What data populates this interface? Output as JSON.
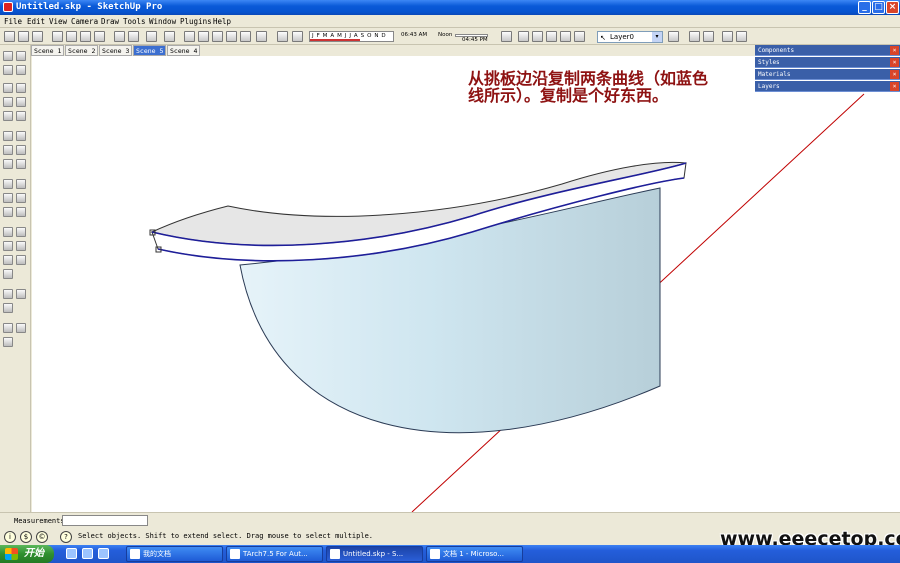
{
  "window": {
    "title": "Untitled.skp - SketchUp Pro",
    "minimize": "_",
    "maximize": "□",
    "close": "×"
  },
  "menu": [
    "File",
    "Edit",
    "View",
    "Camera",
    "Draw",
    "Tools",
    "Window",
    "Plugins",
    "Help"
  ],
  "shadow_bar": {
    "months": "J F M A M J J A S O N D",
    "time_start": "06:43 AM",
    "noon": "Noon",
    "time_end": "04:45 PM"
  },
  "layer": {
    "current": "Layer0",
    "arrow": "▾",
    "cursor": "↖"
  },
  "scenes": [
    {
      "label": "Scene 1",
      "active": false
    },
    {
      "label": "Scene 2",
      "active": false
    },
    {
      "label": "Scene 3",
      "active": false
    },
    {
      "label": "Scene 5",
      "active": true
    },
    {
      "label": "Scene 4",
      "active": false
    }
  ],
  "trays": [
    {
      "label": "Components",
      "close": "×"
    },
    {
      "label": "Styles",
      "close": "×"
    },
    {
      "label": "Materials",
      "close": "×"
    },
    {
      "label": "Layers",
      "close": "×"
    }
  ],
  "annotation": {
    "line1": "从挑板边沿复制两条曲线（如蓝色",
    "line2": "线所示）。复制是个好东西。"
  },
  "model": {
    "face_color": "#d4e8f1",
    "edge_color": "#1e1e99",
    "axis_color": "#c00000"
  },
  "status": {
    "measurements_label": "Measurements",
    "measurements_value": "",
    "hint": "Select objects. Shift to extend select. Drag mouse to select multiple.",
    "icons": [
      "i",
      "$",
      "©",
      "?"
    ]
  },
  "watermark": "www.eeecetop.com",
  "taskbar": {
    "start": "开始",
    "items": [
      {
        "label": "我的文档",
        "active": false
      },
      {
        "label": "TArch7.5 For Aut...",
        "active": false
      },
      {
        "label": "Untitled.skp - S...",
        "active": true
      },
      {
        "label": "文档 1 - Microso...",
        "active": false
      }
    ]
  }
}
